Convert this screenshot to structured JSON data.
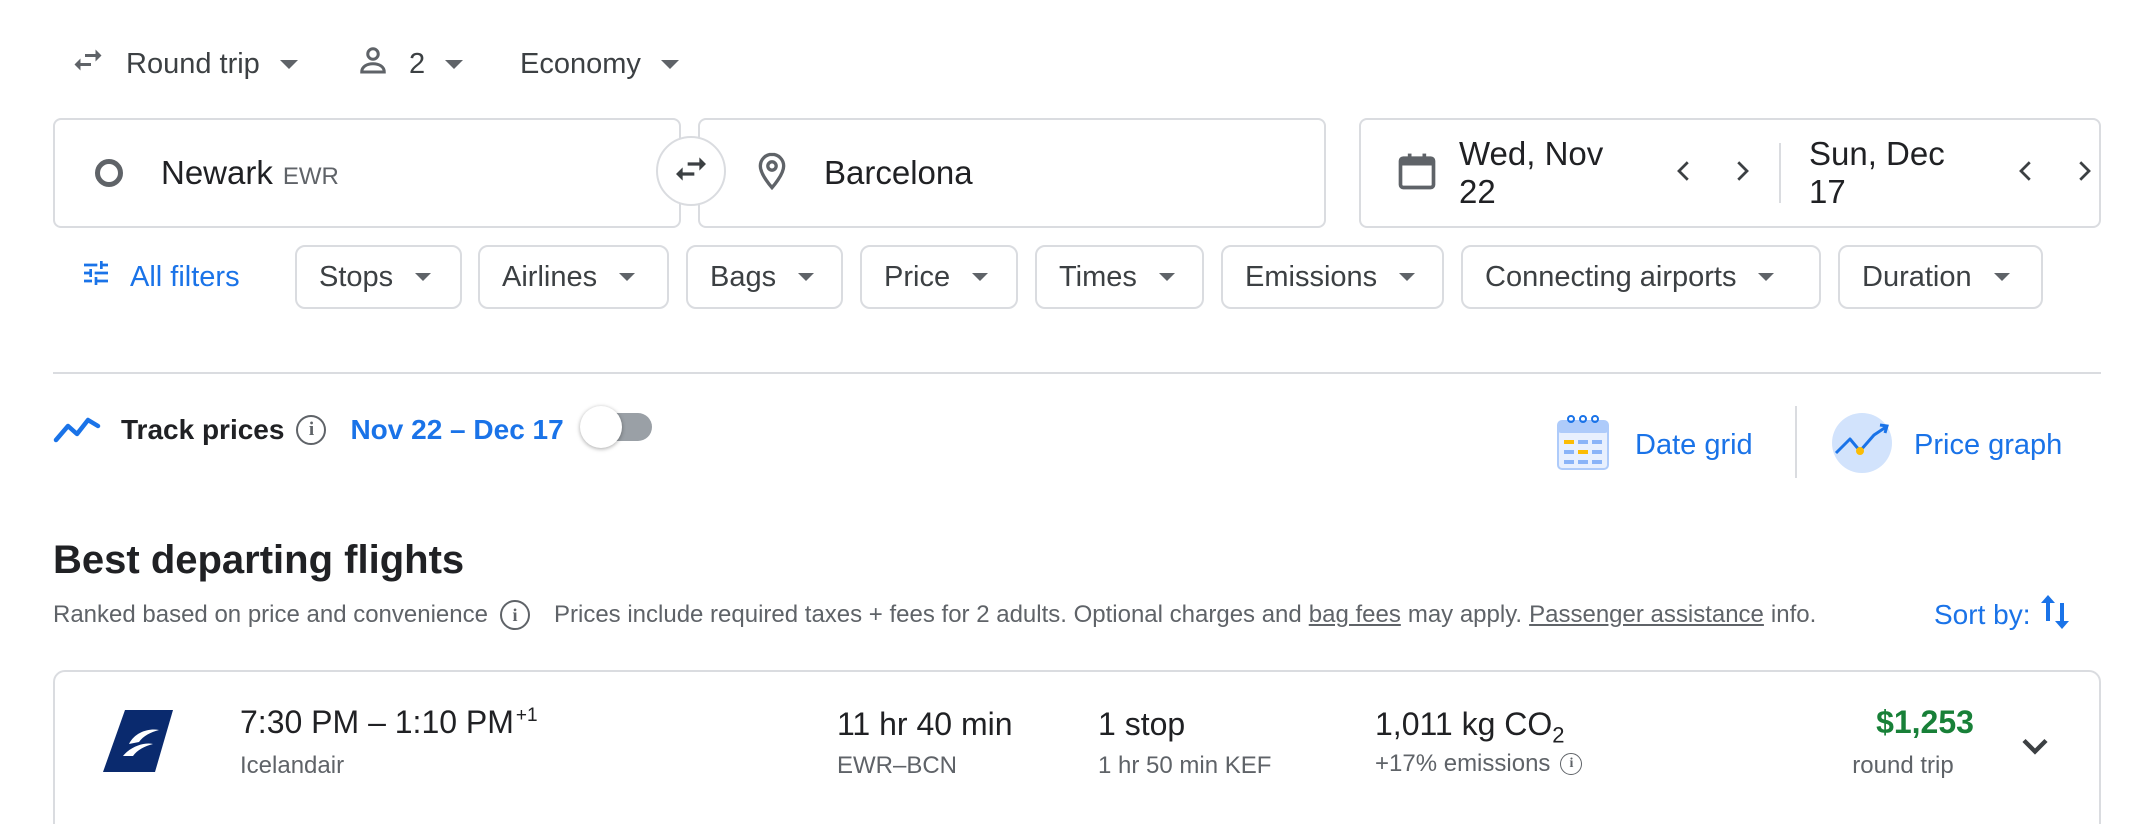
{
  "trip_type": {
    "label": "Round trip"
  },
  "passengers": {
    "count": "2"
  },
  "cabin": {
    "label": "Economy"
  },
  "origin": {
    "city": "Newark",
    "code": "EWR"
  },
  "destination": {
    "city": "Barcelona"
  },
  "dates": {
    "depart": "Wed, Nov 22",
    "return": "Sun, Dec 17"
  },
  "filters": {
    "all_label": "All filters",
    "chips": [
      "Stops",
      "Airlines",
      "Bags",
      "Price",
      "Times",
      "Emissions",
      "Connecting airports",
      "Duration"
    ]
  },
  "track": {
    "label": "Track prices",
    "range": "Nov 22 – Dec 17",
    "enabled": false
  },
  "views": {
    "date_grid": "Date grid",
    "price_graph": "Price graph"
  },
  "results": {
    "heading": "Best departing flights",
    "ranked_text": "Ranked based on price and convenience",
    "notice_prefix": "Prices include required taxes + fees for 2 adults. Optional charges and",
    "bag_fees_link": "bag fees",
    "notice_middle": "may apply.",
    "passenger_link": "Passenger assistance",
    "notice_suffix": "info.",
    "sort_label": "Sort by:"
  },
  "flights": [
    {
      "times": "7:30 PM – 1:10 PM",
      "day_offset": "+1",
      "airline": "Icelandair",
      "duration": "11 hr 40 min",
      "route": "EWR–BCN",
      "stops": "1 stop",
      "layover": "1 hr 50 min KEF",
      "co2_value": "1,011 kg CO",
      "co2_sub": "2",
      "emissions_delta": "+17% emissions",
      "price": "$1,253",
      "price_type": "round trip"
    }
  ],
  "colors": {
    "accent": "#1a73e8",
    "price_green": "#188038",
    "icelandair_navy": "#0a2a6e"
  }
}
